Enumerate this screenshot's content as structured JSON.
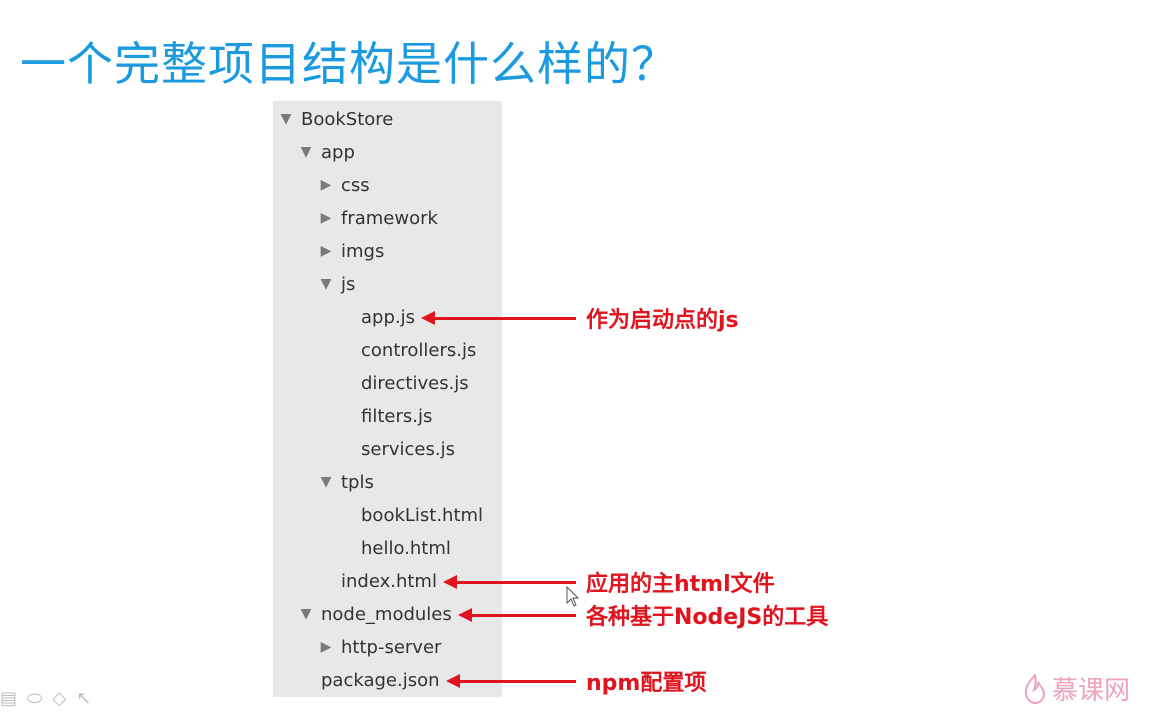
{
  "title": "一个完整项目结构是什么样的？",
  "tree": [
    {
      "label": "BookStore",
      "level": 0,
      "toggle": "expanded"
    },
    {
      "label": "app",
      "level": 1,
      "toggle": "expanded"
    },
    {
      "label": "css",
      "level": 2,
      "toggle": "collapsed"
    },
    {
      "label": "framework",
      "level": 2,
      "toggle": "collapsed"
    },
    {
      "label": "imgs",
      "level": 2,
      "toggle": "collapsed"
    },
    {
      "label": "js",
      "level": 2,
      "toggle": "expanded"
    },
    {
      "label": "app.js",
      "level": 3,
      "toggle": "none"
    },
    {
      "label": "controllers.js",
      "level": 3,
      "toggle": "none"
    },
    {
      "label": "directives.js",
      "level": 3,
      "toggle": "none"
    },
    {
      "label": "filters.js",
      "level": 3,
      "toggle": "none"
    },
    {
      "label": "services.js",
      "level": 3,
      "toggle": "none"
    },
    {
      "label": "tpls",
      "level": 2,
      "toggle": "expanded"
    },
    {
      "label": "bookList.html",
      "level": 3,
      "toggle": "none"
    },
    {
      "label": "hello.html",
      "level": 3,
      "toggle": "none"
    },
    {
      "label": "index.html",
      "level": 2,
      "toggle": "none"
    },
    {
      "label": "node_modules",
      "level": 1,
      "toggle": "expanded"
    },
    {
      "label": "http-server",
      "level": 2,
      "toggle": "collapsed"
    },
    {
      "label": "package.json",
      "level": 1,
      "toggle": "none"
    }
  ],
  "annotations": [
    {
      "text": "作为启动点的js",
      "target": "app.js"
    },
    {
      "text": "应用的主html文件",
      "target": "index.html"
    },
    {
      "text": "各种基于NodeJS的工具",
      "target": "node_modules"
    },
    {
      "text": "npm配置项",
      "target": "package.json"
    }
  ],
  "icons": {
    "expanded": "▼",
    "collapsed": "▶"
  },
  "colors": {
    "title": "#1b9ae0",
    "annotation": "#e0141e",
    "panel": "#e8e8e8",
    "logo": "#eea3b8"
  },
  "logo": {
    "text": "慕课网"
  },
  "toolbar": [
    "slide-icon",
    "pen-icon",
    "eraser-icon",
    "pointer-icon"
  ]
}
